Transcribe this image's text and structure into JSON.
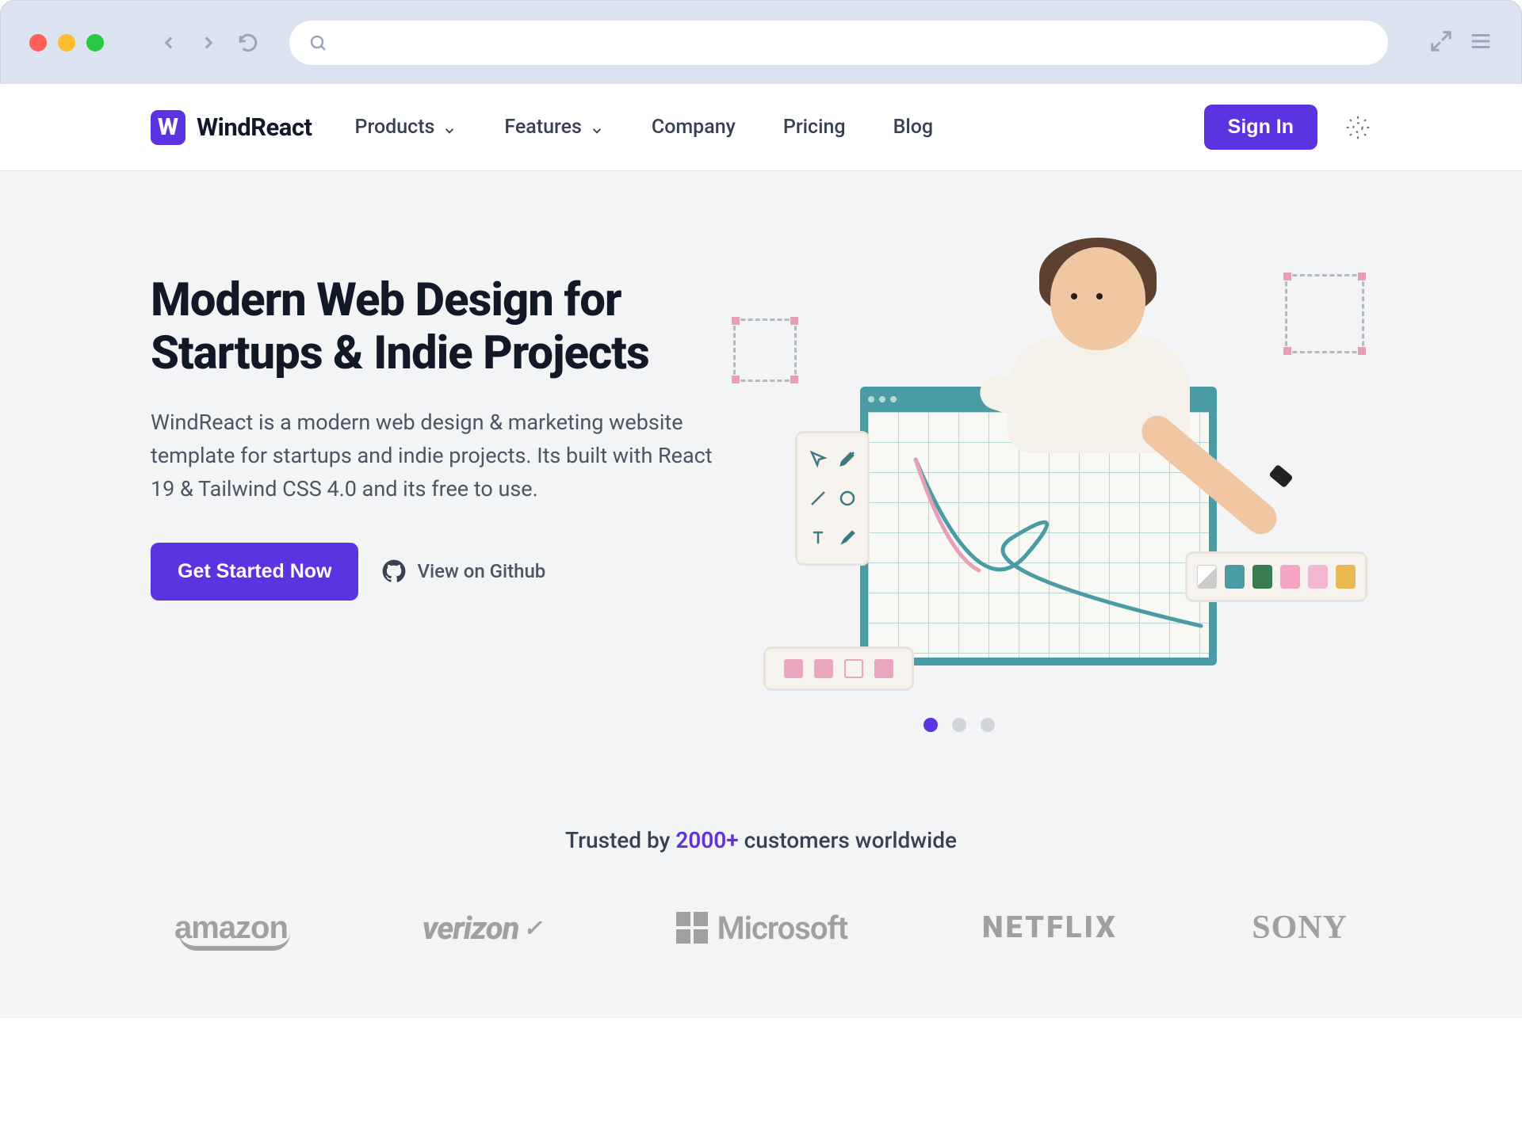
{
  "browser": {
    "search_placeholder": ""
  },
  "site": {
    "brand": "WindReact",
    "logo_letter": "W"
  },
  "nav": {
    "items": [
      {
        "label": "Products",
        "has_dropdown": true
      },
      {
        "label": "Features",
        "has_dropdown": true
      },
      {
        "label": "Company",
        "has_dropdown": false
      },
      {
        "label": "Pricing",
        "has_dropdown": false
      },
      {
        "label": "Blog",
        "has_dropdown": false
      }
    ],
    "signin_label": "Sign In"
  },
  "hero": {
    "title": "Modern Web Design for\nStartups & Indie Projects",
    "description": "WindReact is a modern web design & marketing website template for startups and indie projects. Its built with React 19 & Tailwind CSS 4.0 and its free to use.",
    "cta_primary": "Get Started Now",
    "cta_secondary": "View on Github",
    "carousel": {
      "count": 3,
      "active_index": 0
    }
  },
  "trusted": {
    "prefix": "Trusted by ",
    "count": "2000+",
    "suffix": " customers worldwide",
    "brands": [
      "amazon",
      "verizon",
      "Microsoft",
      "NETFLIX",
      "SONY"
    ]
  },
  "colors": {
    "accent": "#5b33e0",
    "text_primary": "#111827",
    "text_secondary": "#4b5563",
    "hero_bg": "#f3f4f6"
  }
}
